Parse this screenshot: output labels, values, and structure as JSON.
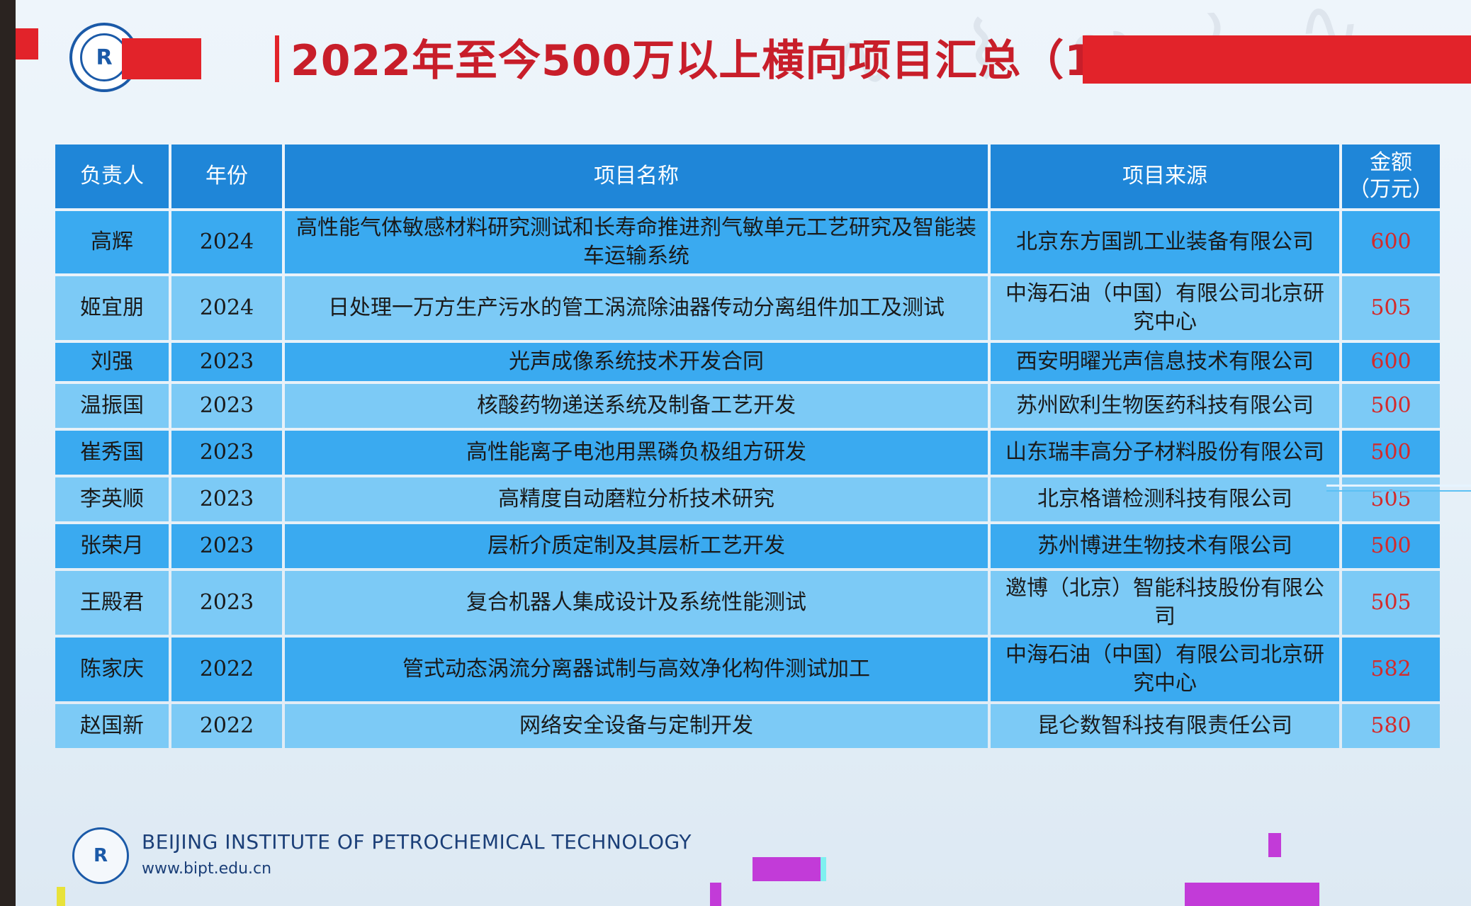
{
  "slide": {
    "title": "2022年至今500万以上横向项目汇总（10项）",
    "colors": {
      "accent_red": "#e2232a",
      "title_red": "#c81e2a",
      "header_blue": "#1f86d8",
      "row_blue": "#3aaaf0",
      "row_light_blue": "#7ccaf6",
      "amount_red": "#d42a2a"
    },
    "logo_icon": "bipt-logo-icon"
  },
  "table": {
    "headers": {
      "person": "负责人",
      "year": "年份",
      "project": "项目名称",
      "source": "项目来源",
      "amount_line1": "金额",
      "amount_line2": "（万元）"
    },
    "rows": [
      {
        "person": "高辉",
        "year": "2024",
        "project": "高性能气体敏感材料研究测试和长寿命推进剂气敏单元工艺研究及智能装车运输系统",
        "source": "北京东方国凯工业装备有限公司",
        "amount": "600"
      },
      {
        "person": "姬宜朋",
        "year": "2024",
        "project": "日处理一万方生产污水的管工涡流除油器传动分离组件加工及测试",
        "source": "中海石油（中国）有限公司北京研究中心",
        "amount": "505"
      },
      {
        "person": "刘强",
        "year": "2023",
        "project": "光声成像系统技术开发合同",
        "source": "西安明曜光声信息技术有限公司",
        "amount": "600"
      },
      {
        "person": "温振国",
        "year": "2023",
        "project": "核酸药物递送系统及制备工艺开发",
        "source": "苏州欧利生物医药科技有限公司",
        "amount": "500"
      },
      {
        "person": "崔秀国",
        "year": "2023",
        "project": "高性能离子电池用黑磷负极组方研发",
        "source": "山东瑞丰高分子材料股份有限公司",
        "amount": "500"
      },
      {
        "person": "李英顺",
        "year": "2023",
        "project": "高精度自动磨粒分析技术研究",
        "source": "北京格谱检测科技有限公司",
        "amount": "505"
      },
      {
        "person": "张荣月",
        "year": "2023",
        "project": "层析介质定制及其层析工艺开发",
        "source": "苏州博进生物技术有限公司",
        "amount": "500"
      },
      {
        "person": "王殿君",
        "year": "2023",
        "project": "复合机器人集成设计及系统性能测试",
        "source": "邀博（北京）智能科技股份有限公司",
        "amount": "505"
      },
      {
        "person": "陈家庆",
        "year": "2022",
        "project": "管式动态涡流分离器试制与高效净化构件测试加工",
        "source": "中海石油（中国）有限公司北京研究中心",
        "amount": "582"
      },
      {
        "person": "赵国新",
        "year": "2022",
        "project": "网络安全设备与定制开发",
        "source": "昆仑数智科技有限责任公司",
        "amount": "580"
      }
    ]
  },
  "footer": {
    "institution": "BEIJING INSTITUTE OF PETROCHEMICAL TECHNOLOGY",
    "url": "www.bipt.edu.cn"
  }
}
